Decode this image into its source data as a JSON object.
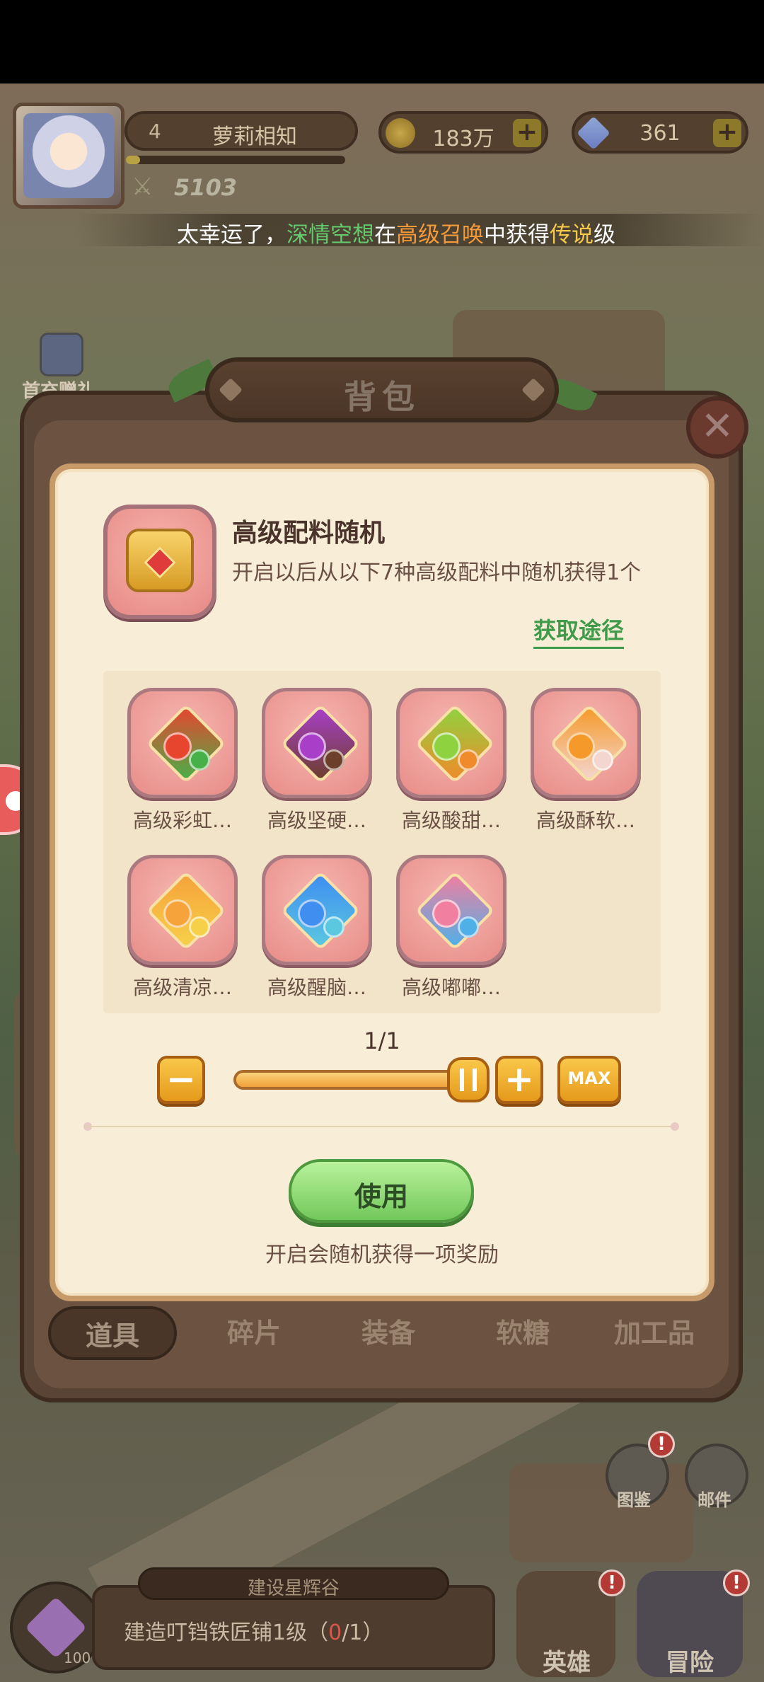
{
  "hud": {
    "level": "4",
    "player_name": "萝莉相知",
    "power": "5103",
    "gold": "183万",
    "diamonds": "361",
    "plus": "+"
  },
  "broadcast": {
    "part1": "太幸运了，",
    "player": "深情空想",
    "part2": "在",
    "source": "高级召唤",
    "part3": "中获得",
    "rarity": "传说",
    "part4": "级"
  },
  "first_gift_label": "首充赠礼",
  "dialog": {
    "title": "背包",
    "close": "✕",
    "item": {
      "name": "高级配料随机",
      "description": "开启以后从以下7种高级配料中随机获得1个",
      "get_path": "获取途径"
    },
    "ingredients": [
      {
        "label": "高级彩虹…",
        "color": "#e8452f",
        "accent": "#48b048"
      },
      {
        "label": "高级坚硬…",
        "color": "#a93fc9",
        "accent": "#6b3f2a"
      },
      {
        "label": "高级酸甜…",
        "color": "#8fd23f",
        "accent": "#f08a2a"
      },
      {
        "label": "高级酥软…",
        "color": "#f59a2a",
        "accent": "#f4d6d0"
      },
      {
        "label": "高级清凉…",
        "color": "#f5a33a",
        "accent": "#f7d04a"
      },
      {
        "label": "高级醒脑…",
        "color": "#3f8ef0",
        "accent": "#5bc8e0"
      },
      {
        "label": "高级嘟嘟…",
        "color": "#f07fa0",
        "accent": "#4fb0e8"
      }
    ],
    "quantity": "1/1",
    "slider_fraction": 1.0,
    "minus": "−",
    "plus": "+",
    "max": "MAX",
    "use_button": "使用",
    "use_hint": "开启会随机获得一项奖励"
  },
  "tabs": [
    {
      "label": "道具",
      "active": true
    },
    {
      "label": "碎片",
      "active": false
    },
    {
      "label": "装备",
      "active": false
    },
    {
      "label": "软糖",
      "active": false
    },
    {
      "label": "加工品",
      "active": false
    }
  ],
  "bottom": {
    "task_header": "建设星辉谷",
    "task_prefix": "建造叮铛铁匠铺1级（",
    "task_progress": "0",
    "task_suffix": "/1）",
    "gem_count": "100",
    "catalog": "图鉴",
    "mail": "邮件",
    "hero": "英雄",
    "adventure": "冒险",
    "badge": "!"
  },
  "colors": {
    "accent_green": "#3f9a4a",
    "button_orange": "#f0a23a",
    "card_bg": "#f8eed7"
  }
}
